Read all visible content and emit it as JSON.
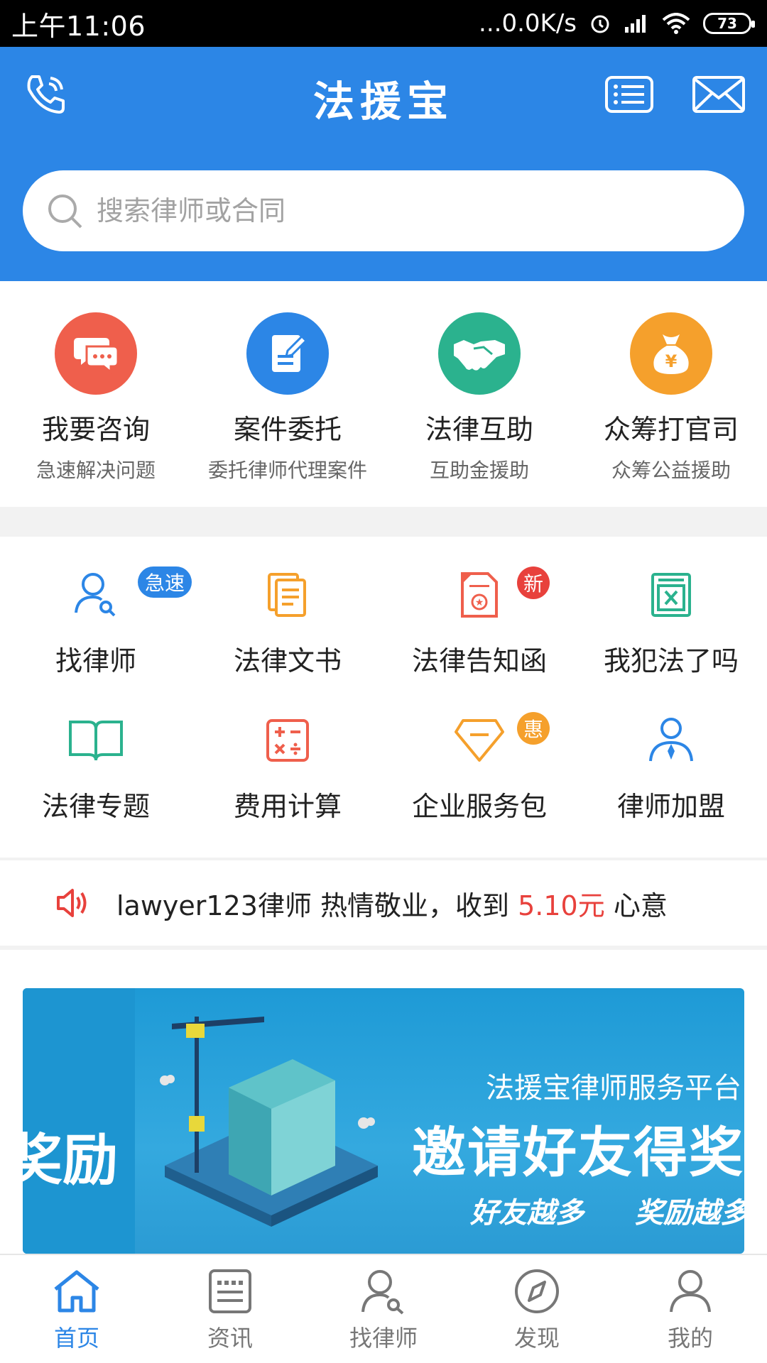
{
  "status_bar": {
    "time": "上午11:06",
    "network": "...0.0K/s",
    "battery": "73"
  },
  "header": {
    "title": "法援宝"
  },
  "search": {
    "placeholder": "搜索律师或合同"
  },
  "services": [
    {
      "label": "我要咨询",
      "sub": "急速解决问题",
      "color": "#ef5f4c"
    },
    {
      "label": "案件委托",
      "sub": "委托律师代理案件",
      "color": "#2c86e6"
    },
    {
      "label": "法律互助",
      "sub": "互助金援助",
      "color": "#2bb28e"
    },
    {
      "label": "众筹打官司",
      "sub": "众筹公益援助",
      "color": "#f5a02c"
    }
  ],
  "tools": [
    {
      "label": "找律师",
      "badge": "急速"
    },
    {
      "label": "法律文书"
    },
    {
      "label": "法律告知函",
      "badge": "新"
    },
    {
      "label": "我犯法了吗"
    },
    {
      "label": "法律专题"
    },
    {
      "label": "费用计算"
    },
    {
      "label": "企业服务包",
      "badge": "惠"
    },
    {
      "label": "律师加盟"
    }
  ],
  "notice": {
    "prefix": "lawyer123律师 热情敬业，收到 ",
    "amount": "5.10元",
    "suffix": " 心意"
  },
  "banner": {
    "left_text": "奖励",
    "subtitle": "法援宝律师服务平台",
    "headline": "邀请好友得奖",
    "slogan_1": "好友越多",
    "slogan_2": "奖励越多"
  },
  "tabbar": [
    {
      "label": "首页",
      "active": true
    },
    {
      "label": "资讯"
    },
    {
      "label": "找律师"
    },
    {
      "label": "发现"
    },
    {
      "label": "我的"
    }
  ],
  "colors": {
    "primary": "#2c86e6",
    "red": "#e8413c",
    "orange": "#f5a02c",
    "teal": "#2bb28e"
  }
}
